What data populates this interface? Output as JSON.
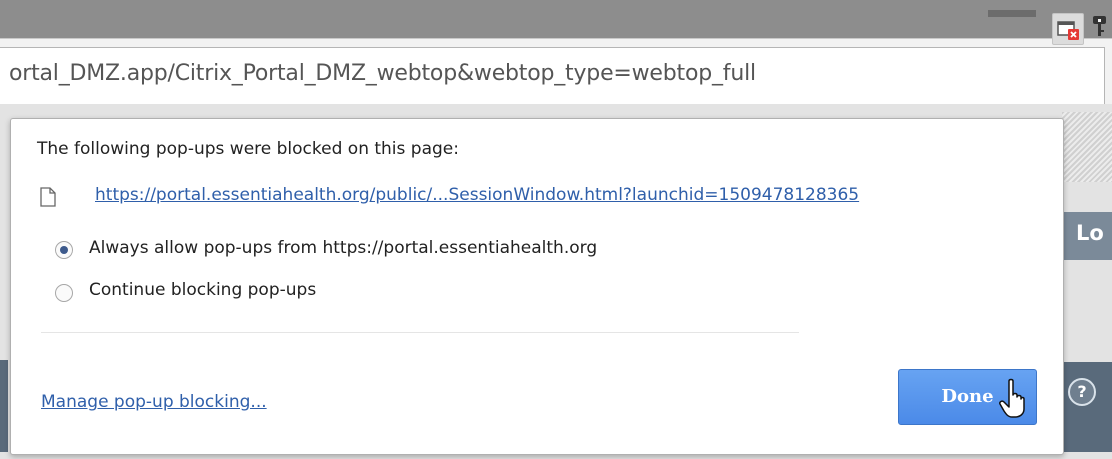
{
  "browser": {
    "url": "ortal_DMZ.app/Citrix_Portal_DMZ_webtop&webtop_type=webtop_full",
    "icons": [
      "popup-blocked-icon",
      "key-icon"
    ]
  },
  "popup_bubble": {
    "heading": "The following pop-ups were blocked on this page:",
    "blocked_link": "https://portal.essentiahealth.org/public/...SessionWindow.html?launchid=1509478128365",
    "options": [
      {
        "label": "Always allow pop-ups from https://portal.essentiahealth.org",
        "selected": true
      },
      {
        "label": "Continue blocking pop-ups",
        "selected": false
      }
    ],
    "manage_link": "Manage pop-up blocking...",
    "done_label": "Done"
  },
  "background_page": {
    "partial_button_text": "Lo",
    "help_icon": "?"
  },
  "colors": {
    "accent": "#4b8ae8",
    "link": "#2f5faa",
    "blocked_badge": "#e53935"
  }
}
